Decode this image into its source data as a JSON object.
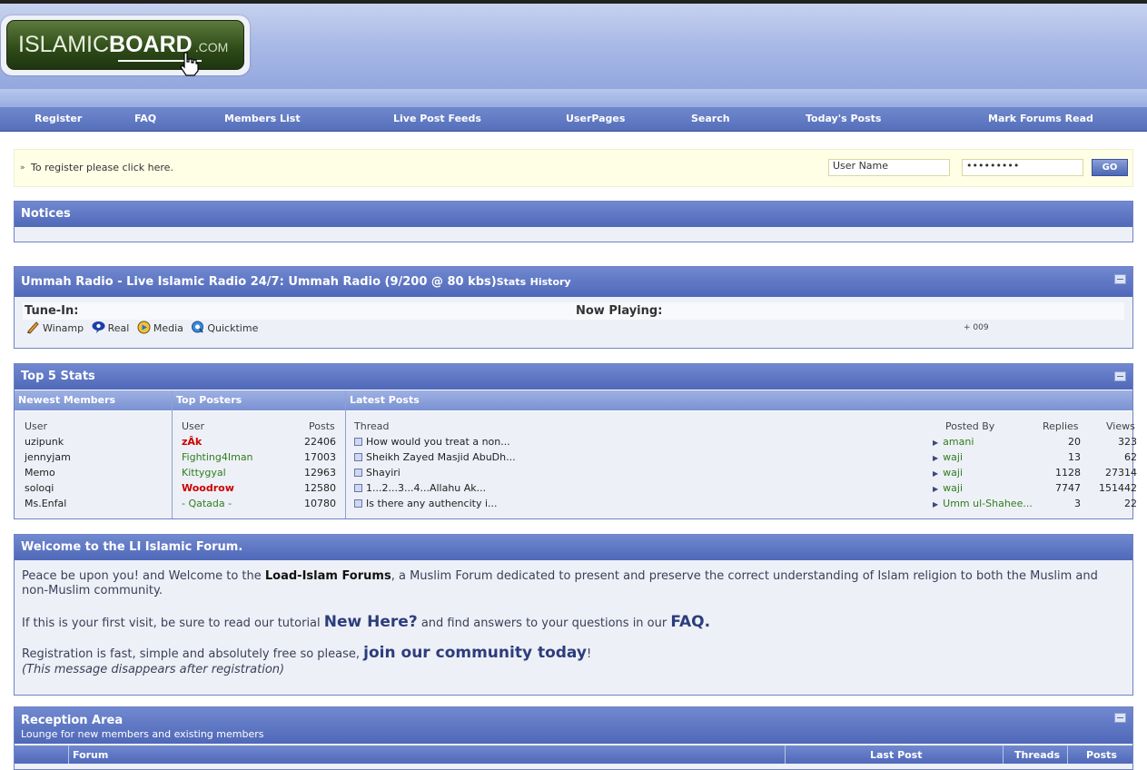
{
  "logo": {
    "text_light": "ISLAMIC",
    "text_bold": "BOARD",
    "text_suffix": ".COM"
  },
  "nav": [
    {
      "label": "Register"
    },
    {
      "label": "FAQ"
    },
    {
      "label": "Members List"
    },
    {
      "label": "Live Post Feeds"
    },
    {
      "label": "UserPages"
    },
    {
      "label": "Search"
    },
    {
      "label": "Today's Posts"
    },
    {
      "label": "Mark Forums Read"
    }
  ],
  "login": {
    "register_text": "To register please click here.",
    "username_value": "User Name",
    "password_value": "•••••••••",
    "go_label": "GO"
  },
  "notices": {
    "title": "Notices"
  },
  "radio": {
    "title": "Ummah Radio - Live Islamic Radio 24/7: Ummah Radio (9/200 @ 80 kbs)",
    "stats_link": "Stats",
    "history_link": "History",
    "tune_in_label": "Tune-In:",
    "now_playing_label": "Now Playing:",
    "players": [
      "Winamp",
      "Real",
      "Media",
      "Quicktime"
    ],
    "now_playing_value": "+ 009"
  },
  "stats": {
    "title": "Top 5 Stats",
    "newest_members": {
      "heading": "Newest Members",
      "col_user": "User",
      "rows": [
        "uzipunk",
        "jennyjam",
        "Memo",
        "soloqi",
        "Ms.Enfal"
      ]
    },
    "top_posters": {
      "heading": "Top Posters",
      "col_user": "User",
      "col_posts": "Posts",
      "rows": [
        {
          "user": "zÂk",
          "posts": "22406"
        },
        {
          "user": "Fighting4Iman",
          "posts": "17003"
        },
        {
          "user": "Kittygyal",
          "posts": "12963"
        },
        {
          "user": "Woodrow",
          "posts": "12580"
        },
        {
          "user": "- Qatada -",
          "posts": "10780"
        }
      ]
    },
    "latest_posts": {
      "heading": "Latest Posts",
      "col_thread": "Thread",
      "col_posted_by": "Posted By",
      "col_replies": "Replies",
      "col_views": "Views",
      "rows": [
        {
          "thread": "How would you treat a non...",
          "by": "amani",
          "replies": "20",
          "views": "323"
        },
        {
          "thread": "Sheikh Zayed Masjid AbuDh...",
          "by": "waji",
          "replies": "13",
          "views": "62"
        },
        {
          "thread": "Shayiri",
          "by": "waji",
          "replies": "1128",
          "views": "27314"
        },
        {
          "thread": "1...2...3...4...Allahu Ak...",
          "by": "waji",
          "replies": "7747",
          "views": "151442"
        },
        {
          "thread": "Is there any authencity i...",
          "by": "Umm ul-Shahee...",
          "replies": "3",
          "views": "22"
        }
      ]
    }
  },
  "welcome": {
    "title": "Welcome to the LI Islamic Forum.",
    "p1_before": "Peace be upon you! and Welcome to the ",
    "p1_brand": "Load-Islam Forums",
    "p1_after": ", a Muslim Forum dedicated to present and preserve the correct understanding of Islam religion to both the Muslim and non-Muslim community.",
    "p2_before": "If this is your first visit, be sure to read our tutorial ",
    "p2_link1": "New Here?",
    "p2_middle": " and find answers to your questions in our ",
    "p2_link2": "FAQ.",
    "p3_before": "Registration is fast, simple and absolutely free so please, ",
    "p3_link": "join our community today",
    "p3_after": "!",
    "p4": "(This message disappears after registration)"
  },
  "reception": {
    "title": "Reception Area",
    "description": "Lounge for new members and existing members",
    "col_forum": "Forum",
    "col_last_post": "Last Post",
    "col_threads": "Threads",
    "col_posts": "Posts"
  },
  "colors": {
    "nav_bg": "#556fbb",
    "panel_head": "#4f68b8",
    "login_bg": "#ffffe6",
    "red_user": "#cc0000",
    "green_user": "#2e7d1f"
  }
}
